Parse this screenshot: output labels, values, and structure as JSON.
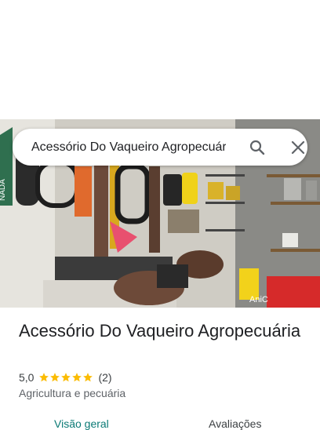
{
  "search": {
    "query": "Acessório Do Vaqueiro Agropecuária"
  },
  "place": {
    "name": "Acessório Do Vaqueiro Agropecuária",
    "rating": "5,0",
    "stars": 5,
    "review_count": "(2)",
    "category": "Agricultura e pecuária"
  },
  "photo": {
    "sign_text": "NADA",
    "bag_text": "AniC"
  },
  "tabs": [
    {
      "label": "Visão geral",
      "active": true
    },
    {
      "label": "Avaliações",
      "active": false
    }
  ],
  "colors": {
    "star": "#fbbc04",
    "active_tab": "#0b7a75",
    "text": "#202124",
    "secondary_text": "#5f6368"
  },
  "icons": [
    "search-icon",
    "close-icon",
    "star-icon"
  ]
}
